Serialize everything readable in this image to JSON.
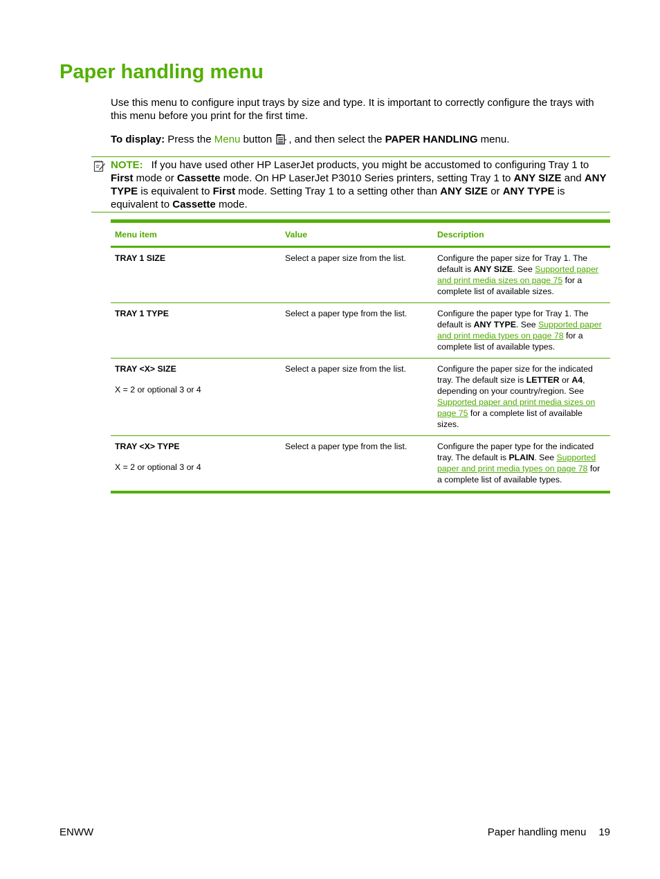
{
  "page": {
    "title": "Paper handling menu",
    "intro": "Use this menu to configure input trays by size and type. It is important to correctly configure the trays with this menu before you print for the first time.",
    "to_display": {
      "label": "To display:",
      "text_before_link": " Press the ",
      "link": "Menu",
      "text_after_link": " button ",
      "icon": "menu-button-icon",
      "text_after_icon": ", and then select the ",
      "menu_name": "PAPER HANDLING",
      "text_end": " menu."
    },
    "note": {
      "icon": "note-icon",
      "label": "NOTE:",
      "segments": [
        {
          "text": "If you have used other HP LaserJet products, you might be accustomed to configuring Tray 1 to ",
          "bold": false
        },
        {
          "text": "First",
          "bold": true
        },
        {
          "text": " mode or ",
          "bold": false
        },
        {
          "text": "Cassette",
          "bold": true
        },
        {
          "text": " mode. On HP LaserJet P3010 Series printers, setting Tray 1 to ",
          "bold": false
        },
        {
          "text": "ANY SIZE",
          "bold": true
        },
        {
          "text": " and ",
          "bold": false
        },
        {
          "text": "ANY TYPE",
          "bold": true
        },
        {
          "text": " is equivalent to ",
          "bold": false
        },
        {
          "text": "First",
          "bold": true
        },
        {
          "text": " mode. Setting Tray 1 to a setting other than ",
          "bold": false
        },
        {
          "text": "ANY SIZE",
          "bold": true
        },
        {
          "text": " or ",
          "bold": false
        },
        {
          "text": "ANY TYPE",
          "bold": true
        },
        {
          "text": " is equivalent to ",
          "bold": false
        },
        {
          "text": "Cassette",
          "bold": true
        },
        {
          "text": " mode.",
          "bold": false
        }
      ]
    },
    "table": {
      "headers": [
        "Menu item",
        "Value",
        "Description"
      ],
      "rows": [
        {
          "item": "TRAY 1 SIZE",
          "sub": "",
          "value": "Select a paper size from the list.",
          "description": [
            {
              "text": "Configure the paper size for Tray 1. The default is ",
              "type": "text"
            },
            {
              "text": "ANY SIZE",
              "type": "bold"
            },
            {
              "text": ". See ",
              "type": "text"
            },
            {
              "text": "Supported paper and print media sizes on page 75",
              "type": "link"
            },
            {
              "text": " for a complete list of available sizes.",
              "type": "text"
            }
          ]
        },
        {
          "item": "TRAY 1 TYPE",
          "sub": "",
          "value": "Select a paper type from the list.",
          "description": [
            {
              "text": "Configure the paper type for Tray 1. The default is ",
              "type": "text"
            },
            {
              "text": "ANY TYPE",
              "type": "bold"
            },
            {
              "text": ". See ",
              "type": "text"
            },
            {
              "text": "Supported paper and print media types on page 78",
              "type": "link"
            },
            {
              "text": " for a complete list of available types.",
              "type": "text"
            }
          ]
        },
        {
          "item": "TRAY <X> SIZE",
          "sub": "X = 2 or optional 3 or 4",
          "value": "Select a paper size from the list.",
          "description": [
            {
              "text": "Configure the paper size for the indicated tray. The default size is ",
              "type": "text"
            },
            {
              "text": "LETTER",
              "type": "bold"
            },
            {
              "text": " or ",
              "type": "text"
            },
            {
              "text": "A4",
              "type": "bold"
            },
            {
              "text": ", depending on your country/region. See ",
              "type": "text"
            },
            {
              "text": "Supported paper and print media sizes on page 75",
              "type": "link"
            },
            {
              "text": " for a complete list of available sizes.",
              "type": "text"
            }
          ]
        },
        {
          "item": "TRAY <X> TYPE",
          "sub": "X = 2 or optional 3 or 4",
          "value": "Select a paper type from the list.",
          "description": [
            {
              "text": "Configure the paper type for the indicated tray. The default is ",
              "type": "text"
            },
            {
              "text": "PLAIN",
              "type": "bold"
            },
            {
              "text": ". See ",
              "type": "text"
            },
            {
              "text": "Supported paper and print media types on page 78",
              "type": "link"
            },
            {
              "text": " for a complete list of available types.",
              "type": "text"
            }
          ]
        }
      ]
    },
    "footer": {
      "left": "ENWW",
      "section": "Paper handling menu",
      "page_number": "19"
    },
    "colors": {
      "accent": "#52b000",
      "link": "#4fa800"
    }
  }
}
